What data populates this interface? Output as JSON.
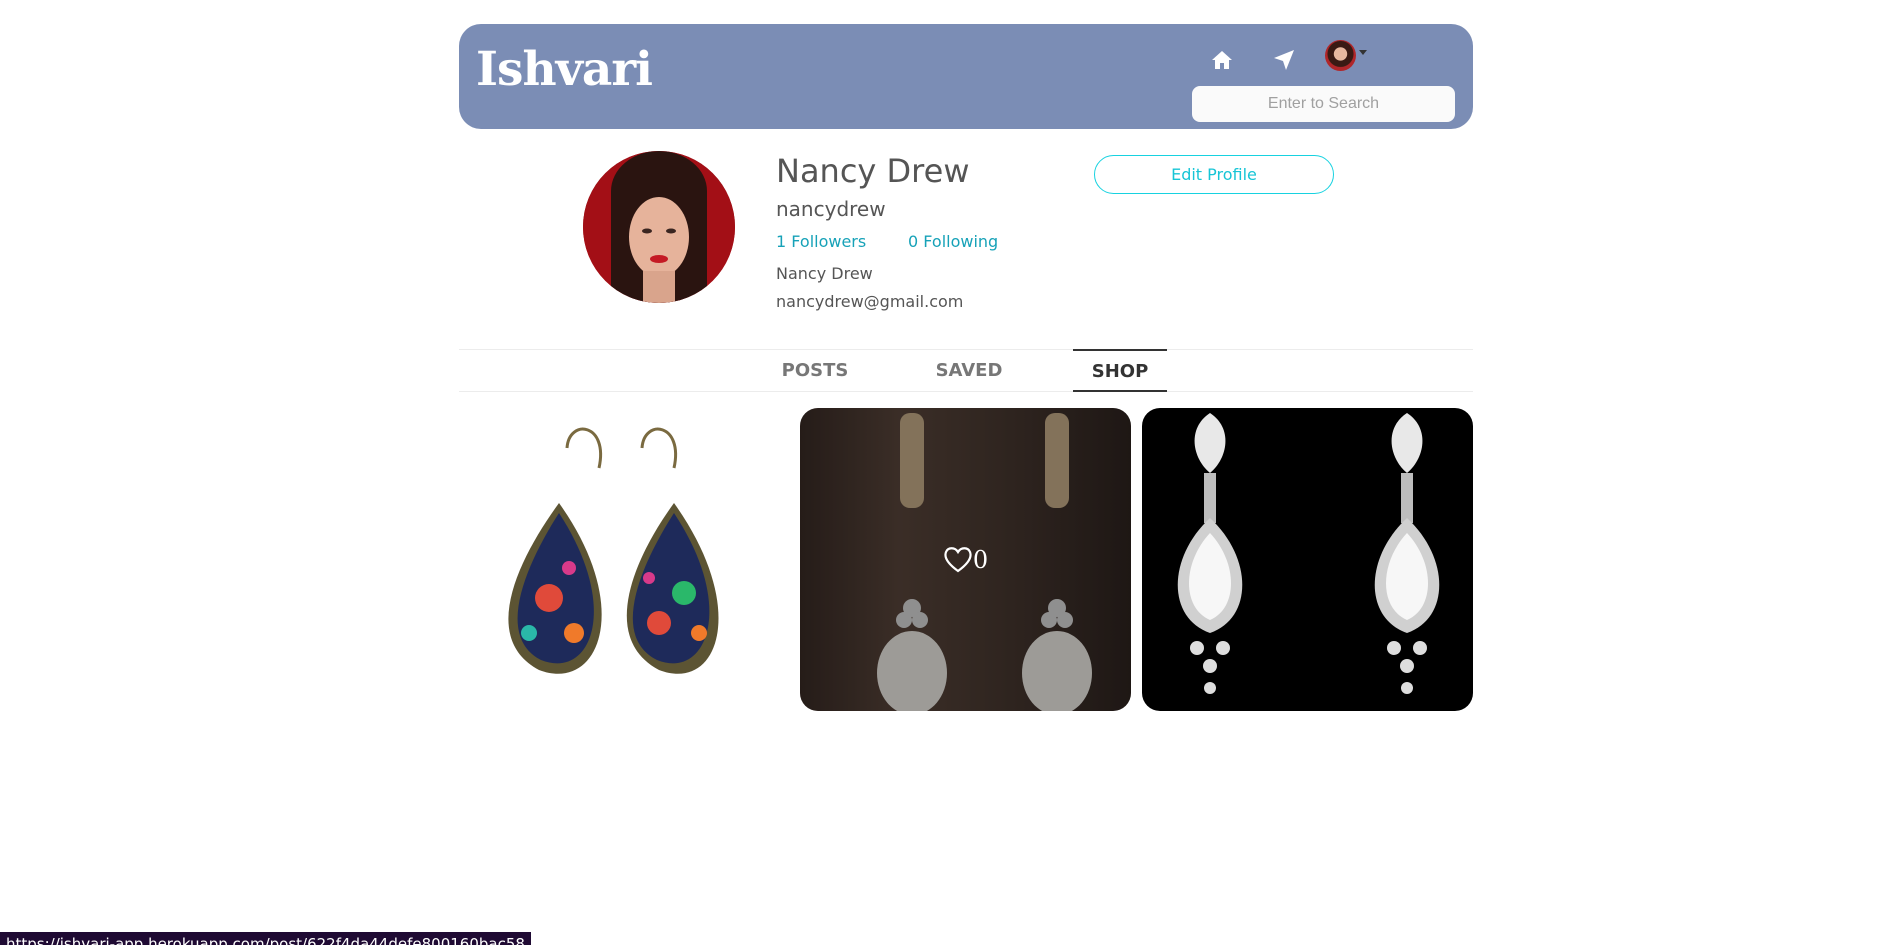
{
  "header": {
    "logo": "Ishvari",
    "search_placeholder": "Enter to Search",
    "icons": [
      "home-icon",
      "send-icon",
      "avatar"
    ]
  },
  "profile": {
    "name": "Nancy Drew",
    "username": "nancydrew",
    "followers": "1 Followers",
    "following": "0 Following",
    "full_name": "Nancy Drew",
    "email": "nancydrew@gmail.com",
    "edit_label": "Edit Profile"
  },
  "tabs": [
    {
      "label": "POSTS",
      "active": false
    },
    {
      "label": "SAVED",
      "active": false
    },
    {
      "label": "SHOP",
      "active": true
    }
  ],
  "shop_items": [
    {
      "type": "paisley teardrop earrings"
    },
    {
      "type": "pearl drop earrings",
      "likes": "0",
      "hovered": true
    },
    {
      "type": "crystal teardrop earrings"
    }
  ],
  "status_url": "https://ishvari-app.herokuapp.com/post/622f4da44defe800160bac58",
  "colors": {
    "header_bg": "#7b8db5",
    "accent": "#17a2b8",
    "edit_border": "#17d2e0"
  }
}
